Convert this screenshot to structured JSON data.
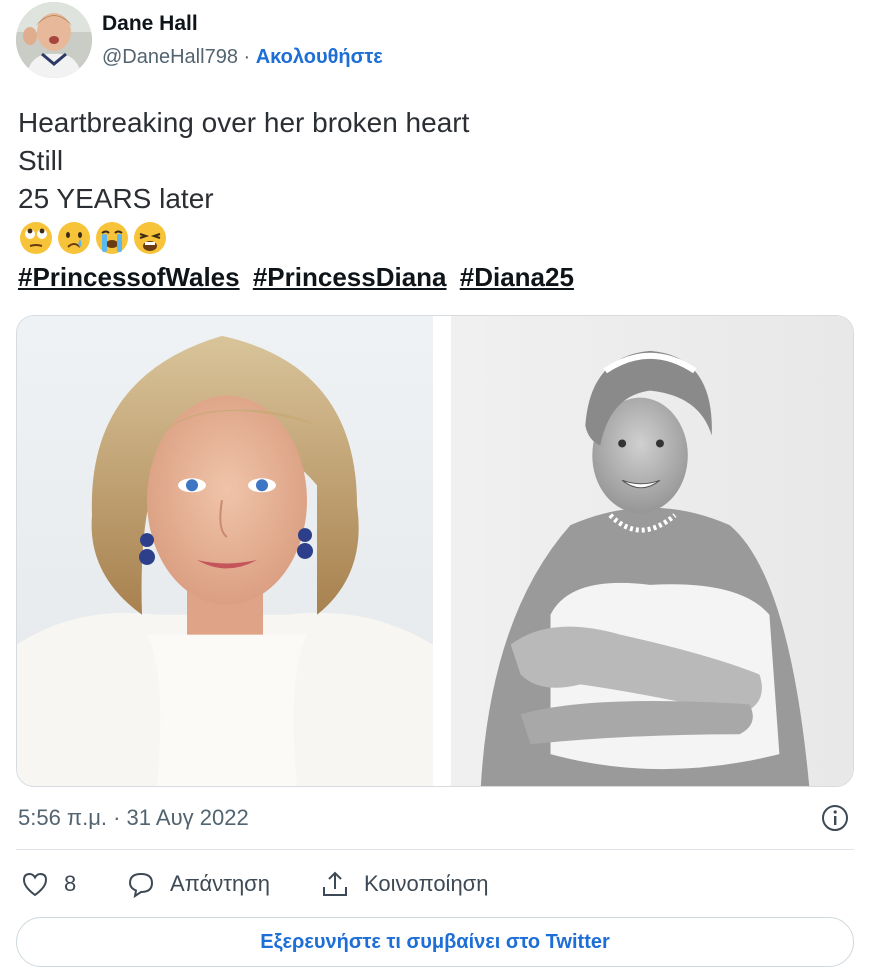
{
  "user": {
    "name": "Dane Hall",
    "handle": "@DaneHall798",
    "separator": " · ",
    "follow_label": "Ακολουθήστε"
  },
  "tweet": {
    "lines": [
      "Heartbreaking over her broken heart",
      "Still",
      "25 YEARS later"
    ],
    "emojis": [
      "face-with-rolling-eyes",
      "crying-face",
      "loudly-crying-face",
      "weary-face"
    ],
    "hashtags": [
      "#PrincessofWales",
      "#PrincessDiana",
      "#Diana25"
    ]
  },
  "media": {
    "photos": [
      "color-portrait",
      "black-and-white-portrait"
    ]
  },
  "timestamp": "5:56 π.μ. · 31 Αυγ 2022",
  "actions": {
    "like_count": "8",
    "reply_label": "Απάντηση",
    "share_label": "Κοινοποίηση"
  },
  "explore_label": "Εξερευνήστε τι συμβαίνει στο Twitter",
  "colors": {
    "accent": "#1d6ed6",
    "muted": "#536471",
    "border": "#cfd9de"
  }
}
